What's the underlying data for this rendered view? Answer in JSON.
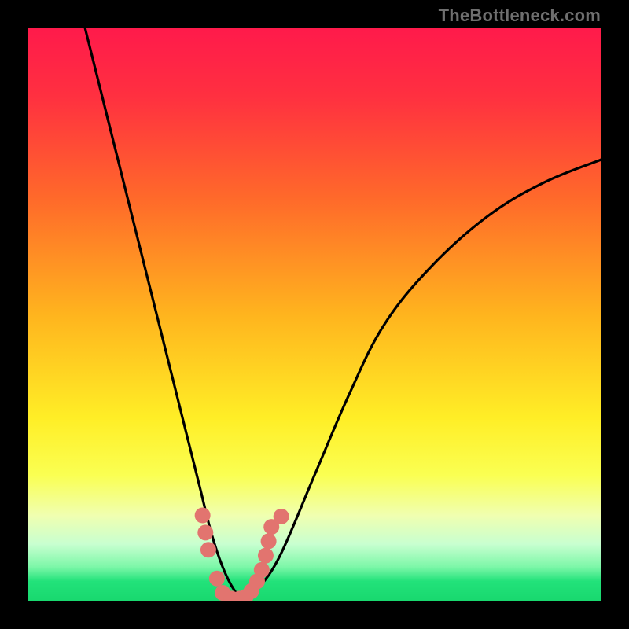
{
  "watermark": "TheBottleneck.com",
  "chart_data": {
    "type": "line",
    "title": "",
    "xlabel": "",
    "ylabel": "",
    "xlim": [
      0,
      100
    ],
    "ylim": [
      0,
      100
    ],
    "gradient_stops": [
      {
        "offset": 0.0,
        "color": "#ff1a4b"
      },
      {
        "offset": 0.12,
        "color": "#ff3040"
      },
      {
        "offset": 0.3,
        "color": "#ff6a2a"
      },
      {
        "offset": 0.5,
        "color": "#ffb41e"
      },
      {
        "offset": 0.68,
        "color": "#ffee26"
      },
      {
        "offset": 0.78,
        "color": "#faff52"
      },
      {
        "offset": 0.85,
        "color": "#f0ffb0"
      },
      {
        "offset": 0.9,
        "color": "#c8ffd0"
      },
      {
        "offset": 0.94,
        "color": "#7cf7a8"
      },
      {
        "offset": 0.965,
        "color": "#22e27a"
      },
      {
        "offset": 1.0,
        "color": "#18d86e"
      }
    ],
    "series": [
      {
        "name": "bottleneck-curve",
        "x": [
          10,
          14,
          18,
          22,
          25,
          28,
          30,
          32,
          34,
          36,
          38,
          40,
          44,
          50,
          56,
          62,
          70,
          80,
          90,
          100
        ],
        "y": [
          100,
          84,
          68,
          52,
          40,
          28,
          20,
          12,
          6,
          2,
          0,
          2,
          8,
          22,
          36,
          48,
          58,
          67,
          73,
          77
        ]
      }
    ],
    "markers": {
      "name": "highlight-points",
      "color": "#e2746f",
      "points": [
        {
          "x": 30.5,
          "y": 15
        },
        {
          "x": 31.0,
          "y": 12
        },
        {
          "x": 31.5,
          "y": 9
        },
        {
          "x": 33.0,
          "y": 4
        },
        {
          "x": 34.0,
          "y": 1.5
        },
        {
          "x": 35.5,
          "y": 0.5
        },
        {
          "x": 37.0,
          "y": 0.5
        },
        {
          "x": 38.0,
          "y": 0.8
        },
        {
          "x": 39.0,
          "y": 1.8
        },
        {
          "x": 40.0,
          "y": 3.5
        },
        {
          "x": 40.8,
          "y": 5.5
        },
        {
          "x": 41.5,
          "y": 8.0
        },
        {
          "x": 42.0,
          "y": 10.5
        },
        {
          "x": 42.5,
          "y": 13.0
        },
        {
          "x": 44.2,
          "y": 14.8
        }
      ]
    }
  }
}
